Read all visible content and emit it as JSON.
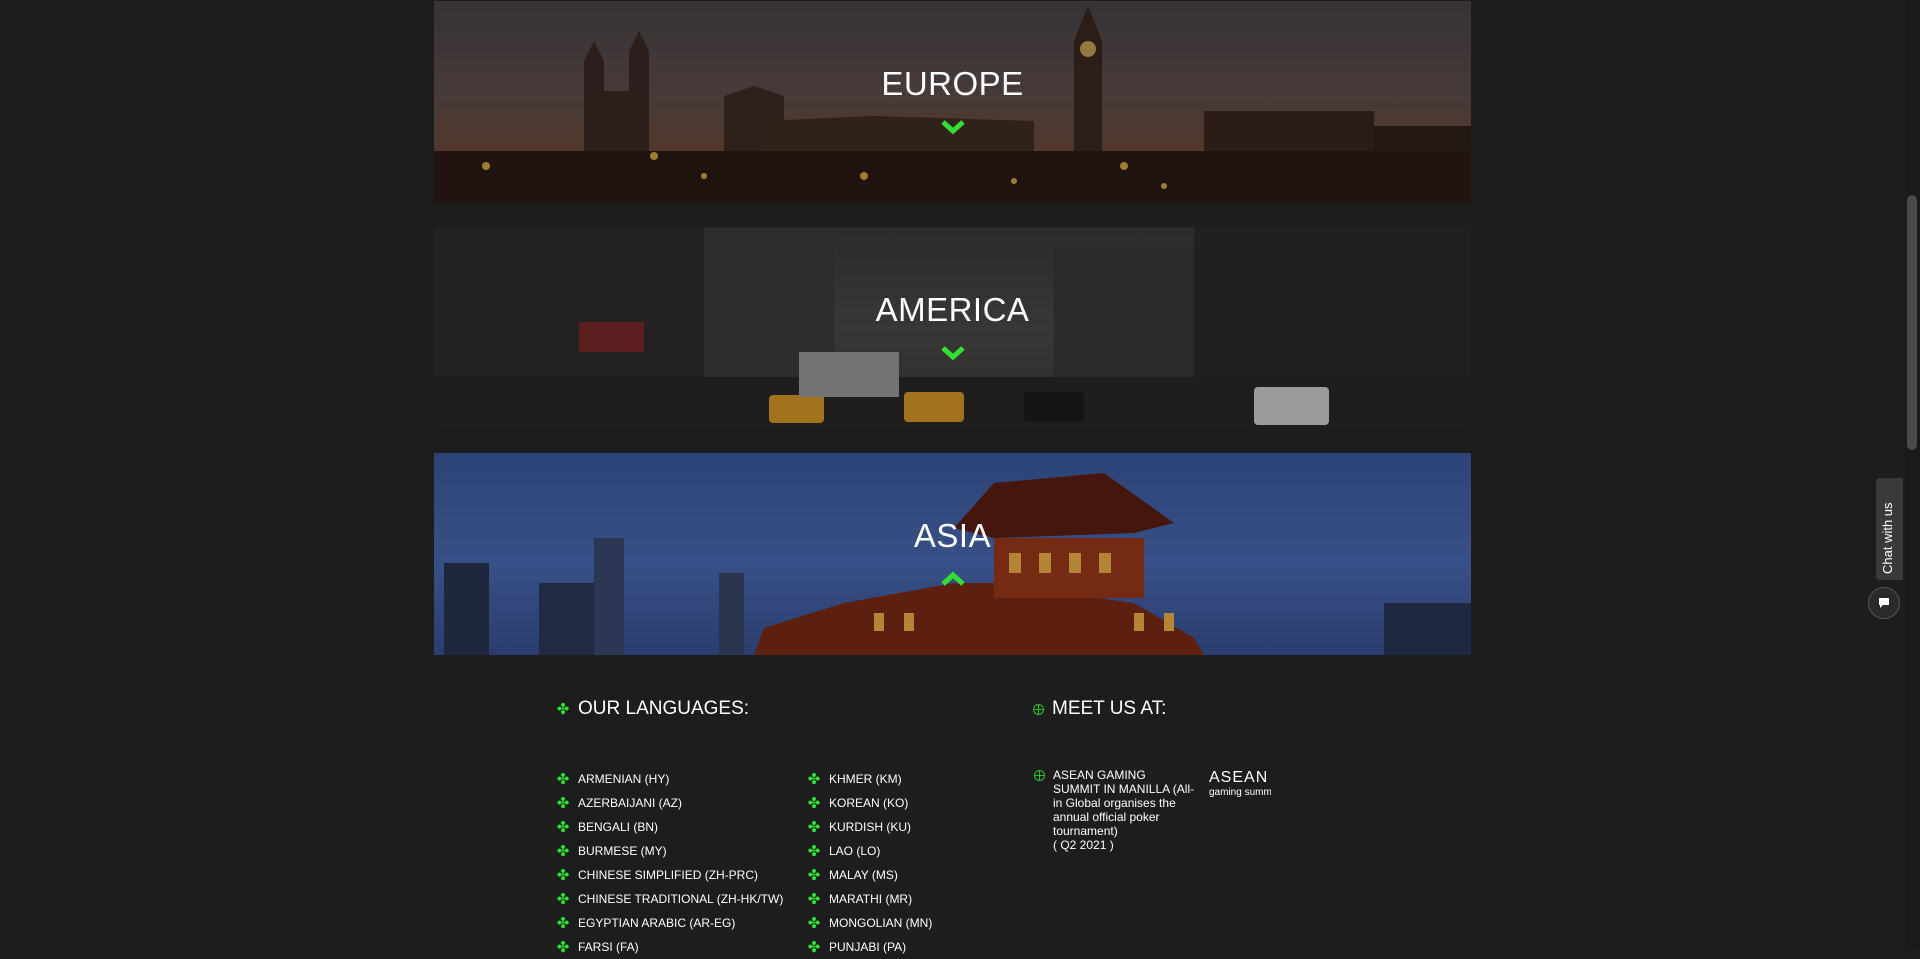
{
  "regions": [
    {
      "name": "EUROPE",
      "state": "collapsed"
    },
    {
      "name": "AMERICA",
      "state": "collapsed"
    },
    {
      "name": "ASIA",
      "state": "expanded"
    }
  ],
  "languages": {
    "title": "OUR LANGUAGES:",
    "column1": [
      "ARMENIAN (HY)",
      "AZERBAIJANI (AZ)",
      "BENGALI (BN)",
      "BURMESE (MY)",
      "CHINESE SIMPLIFIED (ZH-PRC)",
      "CHINESE TRADITIONAL (ZH-HK/TW)",
      "EGYPTIAN ARABIC (AR-EG)",
      "FARSI (FA)"
    ],
    "column2": [
      "KHMER (KM)",
      "KOREAN (KO)",
      "KURDISH (KU)",
      "LAO (LO)",
      "MALAY (MS)",
      "MARATHI (MR)",
      "MONGOLIAN (MN)",
      "PUNJABI (PA)"
    ]
  },
  "meet": {
    "title": "MEET US AT:",
    "event": {
      "text": "ASEAN GAMING SUMMIT IN MANILLA (All-in Global organises the annual official poker tournament)",
      "date": "( Q2 2021 )",
      "logo_line1": "ASEAN",
      "logo_line2": "gaming summit"
    }
  },
  "chat": {
    "label": "Chat with us"
  },
  "colors": {
    "accent": "#33dd33",
    "background": "#1d1d1d"
  },
  "icons": {
    "collapsed": "chevron-down-icon",
    "expanded": "chevron-up-icon",
    "bullet": "clover-icon",
    "meet_bullet": "globe-icon"
  }
}
